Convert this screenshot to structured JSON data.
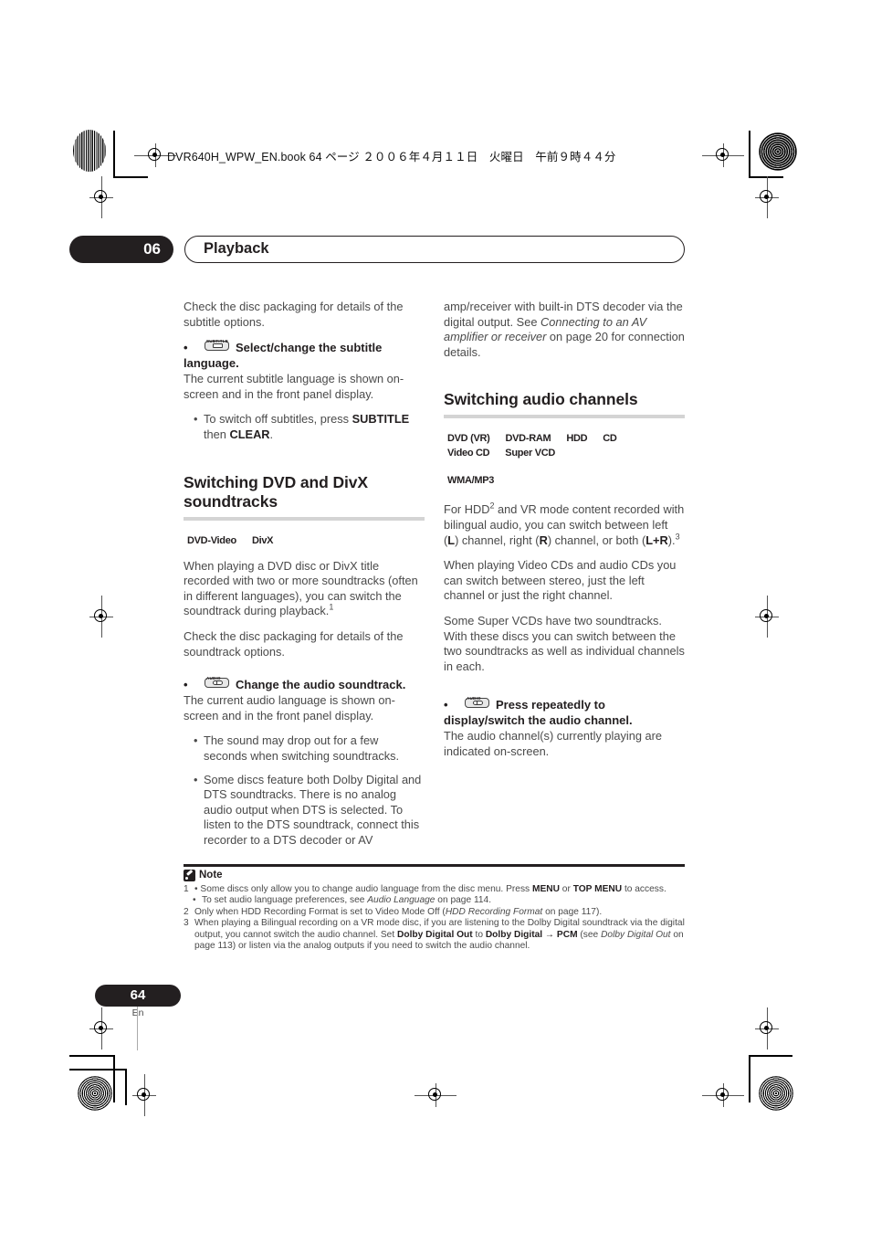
{
  "printer": {
    "file_header": "DVR640H_WPW_EN.book  64 ページ  ２００６年４月１１日　火曜日　午前９時４４分"
  },
  "chapter": {
    "number": "06",
    "title": "Playback"
  },
  "left_column": {
    "intro": "Check the disc packaging for details of the subtitle options.",
    "bullet_subtitle": {
      "icon_label": "SUBTITLE",
      "text": "Select/change the subtitle language."
    },
    "subtitle_desc": "The current subtitle language is shown on-screen and in the front panel display.",
    "subtitle_subbullet_pre": "To switch off subtitles, press ",
    "subtitle_subbullet_kw1": "SUBTITLE",
    "subtitle_subbullet_mid": " then ",
    "subtitle_subbullet_kw2": "CLEAR",
    "subtitle_subbullet_end": ".",
    "section_title": "Switching DVD and DivX soundtracks",
    "badges": [
      "DVD-Video",
      "DivX"
    ],
    "para1_a": "When playing a DVD disc or DivX title recorded with two or more soundtracks (often in different languages), you can switch the soundtrack during playback.",
    "para1_fn": "1",
    "para2": "Check the disc packaging for details of the soundtrack options.",
    "bullet_audio": {
      "icon_label": "AUDIO",
      "text": "Change the audio soundtrack."
    },
    "audio_desc": "The current audio language is shown on-screen and in the front panel display.",
    "audio_sub1": "The sound may drop out for a few seconds when switching soundtracks.",
    "audio_sub2": "Some discs feature both Dolby Digital and DTS soundtracks. There is no analog audio output when DTS is selected. To listen to the DTS soundtrack, connect this recorder to a DTS decoder or AV"
  },
  "right_column": {
    "cont_a": "amp/receiver with built-in DTS decoder via the digital output. See ",
    "cont_italic": "Connecting to an AV amplifier or receiver",
    "cont_b": " on page 20 for connection details.",
    "section_title": "Switching audio channels",
    "badges_row1": [
      "DVD (VR)",
      "DVD-RAM",
      "HDD",
      "CD",
      "Video CD",
      "Super VCD"
    ],
    "badges_row2": [
      "WMA/MP3"
    ],
    "para1_a": "For HDD",
    "para1_fn2": "2",
    "para1_b": " and VR mode content recorded with bilingual audio, you can switch between left (",
    "para1_kw_l": "L",
    "para1_c": ") channel, right (",
    "para1_kw_r": "R",
    "para1_d": ") channel, or both (",
    "para1_kw_lr": "L+R",
    "para1_e": ").",
    "para1_fn3": "3",
    "para2": "When playing Video CDs and audio CDs you can switch between stereo, just the left channel or just the right channel.",
    "para3": "Some Super VCDs have two soundtracks. With these discs you can switch between the two soundtracks as well as individual channels in each.",
    "bullet_audio": {
      "icon_label": "AUDIO",
      "text": "Press repeatedly to display/switch the audio channel."
    },
    "audio_desc": "The audio channel(s) currently playing are indicated on-screen."
  },
  "notes": {
    "title": "Note",
    "n1_num": "1",
    "n1_a": "Some discs only allow you to change audio language from the disc menu. Press ",
    "n1_kw1": "MENU",
    "n1_b": " or ",
    "n1_kw2": "TOP MENU",
    "n1_c": " to access.",
    "n1_sub_a": "To set audio language preferences, see ",
    "n1_sub_it": "Audio Language",
    "n1_sub_b": " on page 114.",
    "n2_num": "2",
    "n2_a": "Only when HDD Recording Format is set to Video Mode Off (",
    "n2_it": "HDD Recording Format",
    "n2_b": " on page 117).",
    "n3_num": "3",
    "n3_a": "When playing a Bilingual recording on a VR mode disc, if you are listening to the Dolby Digital soundtrack via the digital output, you cannot switch the audio channel. Set ",
    "n3_kw1": "Dolby Digital Out",
    "n3_b": " to ",
    "n3_kw2": "Dolby Digital → PCM",
    "n3_c": " (see ",
    "n3_it": "Dolby Digital Out",
    "n3_d": " on page 113) or listen via the analog outputs if you need to switch the audio channel."
  },
  "footer": {
    "page_number": "64",
    "language": "En"
  }
}
